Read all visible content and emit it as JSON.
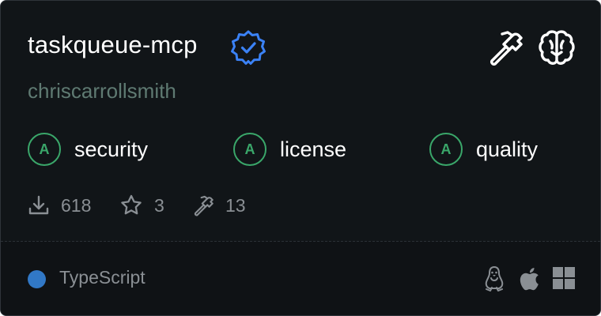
{
  "server": {
    "name": "taskqueue-mcp",
    "author": "chriscarrollsmith"
  },
  "scores": [
    {
      "grade": "A",
      "label": "security"
    },
    {
      "grade": "A",
      "label": "license"
    },
    {
      "grade": "A",
      "label": "quality"
    }
  ],
  "stats": {
    "downloads": "618",
    "stars": "3",
    "tools": "13"
  },
  "language": {
    "name": "TypeScript",
    "color": "#3178c6"
  },
  "colors": {
    "grade_green": "#3aa76a",
    "verified_blue": "#3b82f6"
  },
  "icons": {
    "verified": "verified-badge-icon",
    "tools": "hammer-icon",
    "brain": "brain-icon",
    "download": "download-icon",
    "star": "star-icon",
    "tool_count": "hammer-icon",
    "platforms": [
      "linux-icon",
      "apple-icon",
      "windows-icon"
    ]
  }
}
